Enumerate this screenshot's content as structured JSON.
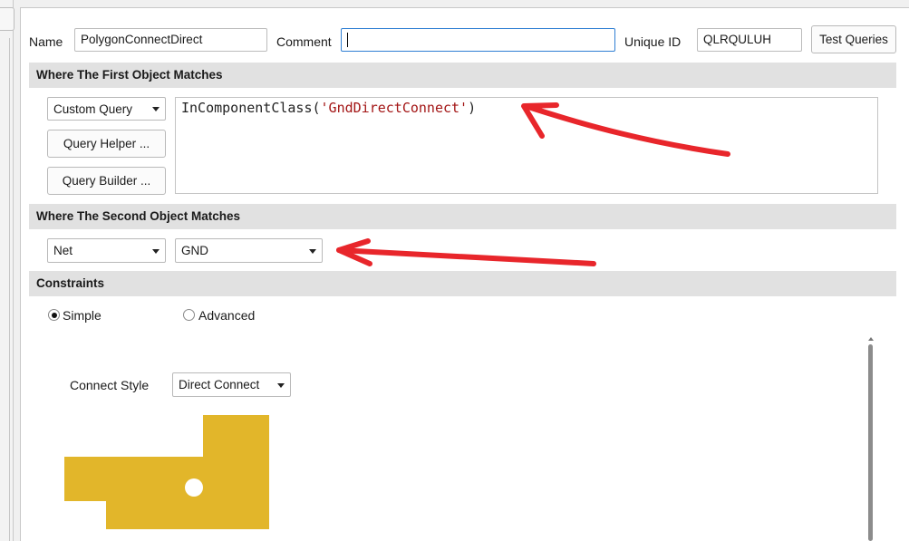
{
  "header": {
    "name_label": "Name",
    "name_value": "PolygonConnectDirect",
    "comment_label": "Comment",
    "comment_value": "",
    "unique_id_label": "Unique ID",
    "unique_id_value": "QLRQULUH",
    "test_queries_label": "Test Queries"
  },
  "first_object": {
    "title": "Where The First Object Matches",
    "type_selected": "Custom Query",
    "query_helper_label": "Query Helper ...",
    "query_builder_label": "Query Builder ...",
    "query_prefix": "InComponentClass(",
    "query_string": "'GndDirectConnect'",
    "query_suffix": ")"
  },
  "second_object": {
    "title": "Where The Second Object Matches",
    "type_selected": "Net",
    "net_selected": "GND"
  },
  "constraints": {
    "title": "Constraints",
    "simple_label": "Simple",
    "advanced_label": "Advanced",
    "mode_selected": "Simple",
    "connect_style_label": "Connect Style",
    "connect_style_selected": "Direct Connect"
  },
  "colors": {
    "annotation_arrow": "#e8262b",
    "polygon_fill": "#e2b62a",
    "query_string_color": "#a31515",
    "active_field_border": "#2f7fd3"
  }
}
